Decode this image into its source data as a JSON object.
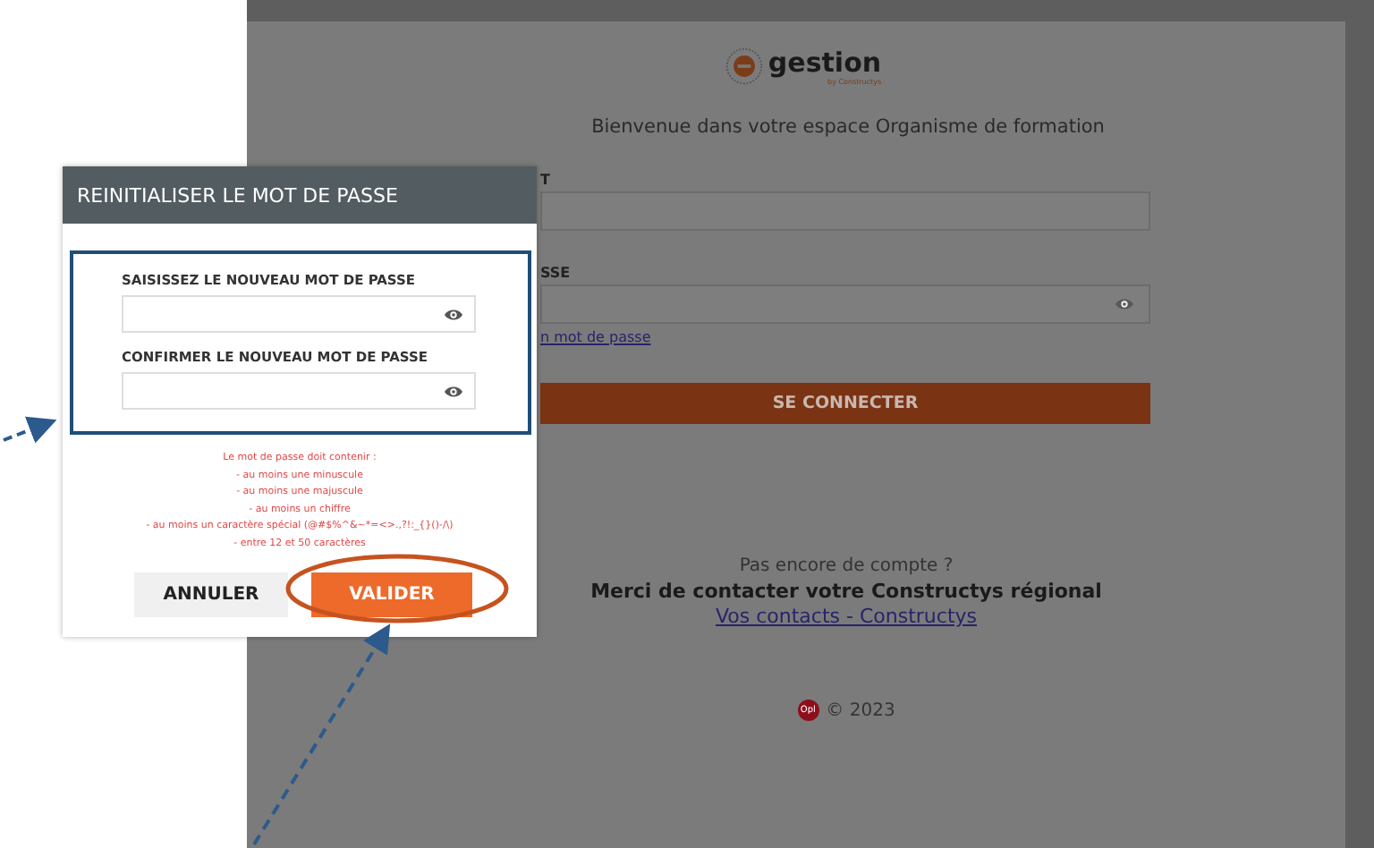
{
  "login": {
    "logo": {
      "name": "gestion",
      "tagline": "by Constructys"
    },
    "welcome": "Bienvenue dans votre espace Organisme de formation",
    "fields": [
      {
        "label": "T",
        "eye": false
      },
      {
        "label": "SSE",
        "eye": true
      }
    ],
    "forgot_link": "n mot de passe",
    "submit": "SE CONNECTER",
    "no_account": "Pas encore de compte ?",
    "contact": "Merci de contacter votre Constructys régional",
    "contacts_link": "Vos contacts - Constructys",
    "footer": {
      "badge": "Opl",
      "copyright": "© 2023"
    }
  },
  "dialog": {
    "title": "REINITIALISER LE MOT DE PASSE",
    "fields": [
      {
        "label": "SAISISSEZ LE NOUVEAU MOT DE PASSE"
      },
      {
        "label": "CONFIRMER LE NOUVEAU MOT DE PASSE"
      }
    ],
    "rules": [
      "Le mot de passe doit contenir :",
      "- au moins une minuscule",
      "- au moins une majuscule",
      "- au moins un chiffre",
      "- au moins un caractère spécial (@#$%^&~*=<>.,?!:_{}()-/\\)",
      "- entre 12 et 50 caractères"
    ],
    "buttons": [
      {
        "label": "ANNULER",
        "kind": "secondary"
      },
      {
        "label": "VALIDER",
        "kind": "primary"
      }
    ]
  }
}
